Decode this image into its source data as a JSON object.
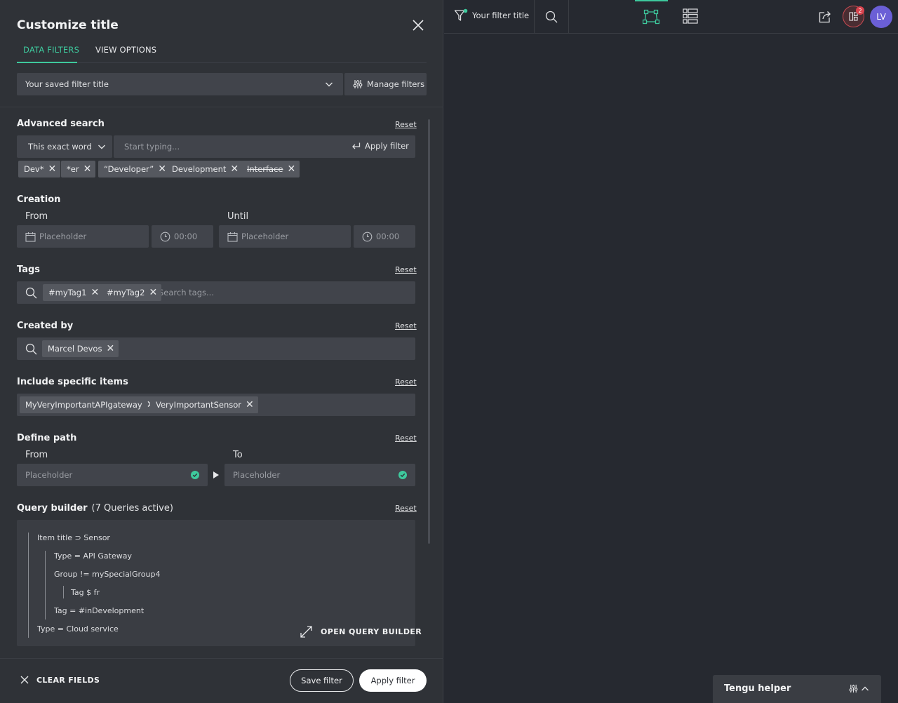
{
  "panel": {
    "title": "Customize title",
    "tabs": [
      {
        "label": "DATA FILTERS"
      },
      {
        "label": "VIEW OPTIONS"
      }
    ],
    "saved_filter": "Your saved filter title",
    "manage_filters": "Manage filters"
  },
  "advanced_search": {
    "title": "Advanced search",
    "reset": "Reset",
    "match_mode": "This exact word",
    "placeholder": "Start typing...",
    "apply": "Apply filter",
    "chips": [
      "Dev*",
      "*er",
      "“Developer”",
      "Development",
      "Interface"
    ]
  },
  "creation": {
    "title": "Creation",
    "from_label": "From",
    "until_label": "Until",
    "date_placeholder": "Placeholder",
    "time_placeholder": "00:00"
  },
  "tags": {
    "title": "Tags",
    "reset": "Reset",
    "chips": [
      "#myTag1",
      "#myTag2"
    ],
    "placeholder": "Search tags..."
  },
  "created_by": {
    "title": "Created by",
    "reset": "Reset",
    "chips": [
      "Marcel Devos"
    ]
  },
  "include_items": {
    "title": "Include specific items",
    "reset": "Reset",
    "chips": [
      "MyVeryImportantAPIgateway",
      "VeryImportantSensor"
    ]
  },
  "define_path": {
    "title": "Define path",
    "reset": "Reset",
    "from_label": "From",
    "to_label": "To",
    "from_placeholder": "Placeholder",
    "to_placeholder": "Placeholder"
  },
  "query_builder": {
    "title": "Query builder",
    "count": "(7 Queries active)",
    "reset": "Reset",
    "lines": [
      "Item title ⊃ Sensor",
      "Type = API Gateway",
      "Group != mySpecialGroup4",
      "Tag $ fr",
      "Tag = #inDevelopment",
      "Type = Cloud service"
    ],
    "open": "OPEN QUERY BUILDER"
  },
  "footer": {
    "clear": "CLEAR FIELDS",
    "save": "Save filter",
    "apply": "Apply filter"
  },
  "topbar": {
    "filter_title": "Your filter title",
    "notification_count": "2",
    "avatar": "LV"
  },
  "helper": {
    "title": "Tengu helper"
  },
  "colors": {
    "accent": "#3ec99d",
    "panel_bg": "#2f3237",
    "canvas_bg": "#262930",
    "avatar": "#6b5fd6",
    "notification": "#d9434e"
  }
}
